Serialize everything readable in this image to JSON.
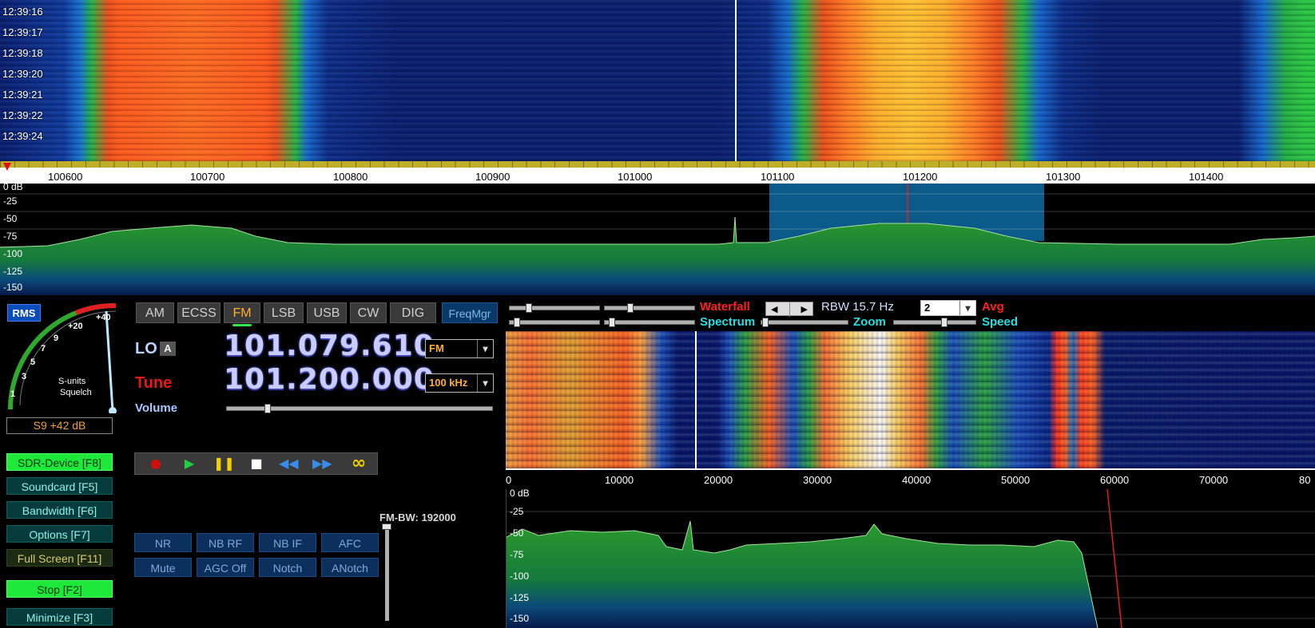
{
  "top_waterfall": {
    "time_labels": [
      "12:39:16",
      "12:39:17",
      "12:39:18",
      "12:39:20",
      "12:39:21",
      "12:39:22",
      "12:39:24"
    ]
  },
  "freq_ruler": {
    "labels": [
      "100600",
      "100700",
      "100800",
      "100900",
      "101000",
      "101100",
      "101200",
      "101300",
      "101400"
    ]
  },
  "top_spectrum": {
    "db_labels": [
      "0 dB",
      "-25",
      "-50",
      "-75",
      "-100",
      "-125",
      "-150"
    ]
  },
  "smeter": {
    "badge": "RMS",
    "scale": [
      "1",
      "3",
      "5",
      "7",
      "9",
      "+20",
      "+40"
    ],
    "caption_1": "S-units",
    "caption_2": "Squelch",
    "readout": "S9 +42 dB"
  },
  "modes": {
    "items": [
      "AM",
      "ECSS",
      "FM",
      "LSB",
      "USB",
      "CW",
      "DIG"
    ],
    "active": "FM",
    "freqmgr": "FreqMgr"
  },
  "lo": {
    "label": "LO",
    "badge": "A",
    "frequency": "101.079.610",
    "select_value": "FM"
  },
  "tune": {
    "label": "Tune",
    "frequency": "101.200.000",
    "step_value": "100 kHz"
  },
  "volume": {
    "label": "Volume",
    "level": 0.12
  },
  "side_buttons": {
    "sdr_device": "SDR-Device [F8]",
    "soundcard": "Soundcard [F5]",
    "bandwidth": "Bandwidth [F6]",
    "options": "Options [F7]",
    "full_screen": "Full Screen [F11]",
    "stop": "Stop [F2]",
    "minimize": "Minimize [F3]"
  },
  "dsp": {
    "row1": [
      "NR",
      "NB RF",
      "NB IF",
      "AFC"
    ],
    "row2": [
      "Mute",
      "AGC Off",
      "Notch",
      "ANotch"
    ]
  },
  "fm_bw": {
    "label": "FM-BW: 192000"
  },
  "display_controls": {
    "waterfall": "Waterfall",
    "spectrum": "Spectrum",
    "zoom": "Zoom",
    "rbw": "RBW 15.7 Hz",
    "avg_value": "2",
    "avg": "Avg",
    "speed": "Speed"
  },
  "zoom_ruler": {
    "labels": [
      "0",
      "10000",
      "20000",
      "30000",
      "40000",
      "50000",
      "60000",
      "70000",
      "80"
    ]
  },
  "zoom_spectrum": {
    "db_labels": [
      "0 dB",
      "-25",
      "-50",
      "-75",
      "-100",
      "-125",
      "-150"
    ]
  },
  "colors": {
    "active_green": "#1ee83a",
    "tune_red": "#e81818",
    "lo_blue": "#bcd0ff",
    "waterfall_red": "#ff2020",
    "spectrum_cyan": "#22e0e0"
  }
}
